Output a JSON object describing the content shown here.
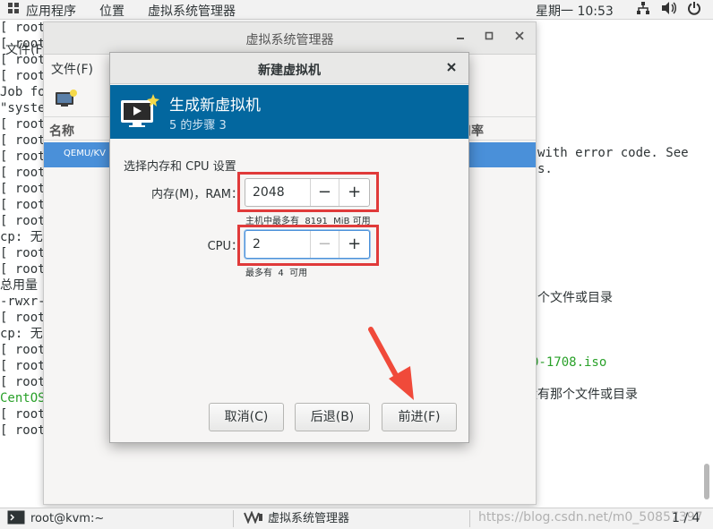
{
  "topbar": {
    "applications": "应用程序",
    "places": "位置",
    "active_app": "虚拟系统管理器",
    "clock": "星期一 10:53",
    "network_icon": "network-icon",
    "volume_icon": "volume-icon",
    "power_icon": "power-icon"
  },
  "terminal": {
    "menu_file": "文件(F",
    "lines": [
      {
        "text": "[ root@",
        "color": "normal"
      },
      {
        "text": "[ root@",
        "color": "normal"
      },
      {
        "text": "[ root@",
        "color": "normal"
      },
      {
        "text": "[ root@",
        "color": "normal"
      },
      {
        "text": "Job fo",
        "color": "normal"
      },
      {
        "text": "\"syste",
        "color": "normal"
      },
      {
        "text": "[ root@",
        "color": "normal"
      },
      {
        "text": "[ root@",
        "color": "normal"
      },
      {
        "text": "[ root@",
        "color": "normal"
      },
      {
        "text": "[ root@",
        "color": "normal"
      },
      {
        "text": "[ root@",
        "color": "normal"
      },
      {
        "text": "[ root@",
        "color": "normal"
      },
      {
        "text": "[ root@",
        "color": "normal"
      },
      {
        "text": "cp: 无",
        "color": "normal"
      },
      {
        "text": "[ root@",
        "color": "normal"
      },
      {
        "text": "[ root@",
        "color": "normal"
      },
      {
        "text": "总用量",
        "color": "normal"
      },
      {
        "text": "-rwxr-",
        "color": "normal"
      },
      {
        "text": "[ root@",
        "color": "normal"
      },
      {
        "text": "cp: 无",
        "color": "normal"
      },
      {
        "text": "[ root@",
        "color": "normal"
      },
      {
        "text": "[ root@",
        "color": "normal"
      },
      {
        "text": "[ root@",
        "color": "normal"
      },
      {
        "text": "CentOS",
        "color": "green"
      },
      {
        "text": "[ root@",
        "color": "normal"
      },
      {
        "text": "[ root@",
        "color": "normal"
      }
    ],
    "right_1": "with error code. See",
    "right_2": "s.",
    "right_3": "个文件或目录",
    "right_4": "0-1708.iso",
    "right_5": "没有那个文件或目录"
  },
  "vmm": {
    "title": "虚拟系统管理器",
    "menu_file": "文件(F)",
    "col_name": "名称",
    "col_rate": "用率",
    "row_label": "QEMU/KV"
  },
  "dialog": {
    "title": "新建虚拟机",
    "banner_title": "生成新虚拟机",
    "banner_step": "5 的步骤 3",
    "section": "选择内存和 CPU 设置",
    "memory_label": "内存(M)，RAM：",
    "memory_value": "2048",
    "memory_hint": "主机中最多有  8191  MiB 可用",
    "cpu_label": "CPU：",
    "cpu_value": "2",
    "cpu_hint": "最多有  4  可用",
    "minus": "−",
    "plus": "+",
    "cancel": "取消(C)",
    "back": "后退(B)",
    "forward": "前进(F)",
    "close": "×"
  },
  "taskbar": {
    "terminal_task": "root@kvm:~",
    "vmm_task": "虚拟系统管理器",
    "workspace": "1 / 4",
    "watermark": "https://blog.csdn.net/m0_50857397"
  },
  "colors": {
    "banner": "#03679f",
    "selection": "#4a90d9",
    "highlight_box": "#e03a3a",
    "arrow": "#f04a3a",
    "terminal_green": "#2aa12a"
  }
}
